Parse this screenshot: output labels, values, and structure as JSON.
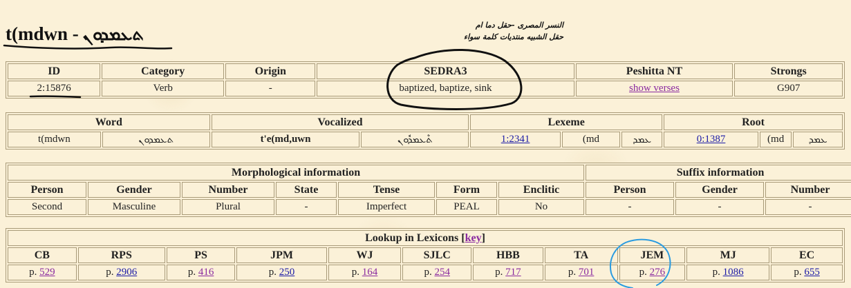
{
  "page_title": {
    "text": "t(mdwn -",
    "syriac": "ܬܥܡܕܘܢ"
  },
  "arabic_note": {
    "line1": "النسر المصرى   -حقل دما ام",
    "line2": "حقل الشبيه منتديات كلمة سواء"
  },
  "table1": {
    "headers": [
      "ID",
      "Category",
      "Origin",
      "SEDRA3",
      "Peshitta NT",
      "Strongs"
    ],
    "values": {
      "id": "2:15876",
      "category": "Verb",
      "origin": "-",
      "sedra3": "baptized, baptize, sink",
      "peshitta": "show verses",
      "strongs": "G907"
    }
  },
  "table2": {
    "headers": [
      "Word",
      "Vocalized",
      "Lexeme",
      "Root"
    ],
    "word": {
      "latin": "t(mdwn",
      "syriac": "ܬܥܡܕܘܢ"
    },
    "vocalized": {
      "latin": "t'e(md,uwn",
      "syriac": "ܬܶܥܡܕܽܘܢ"
    },
    "lexeme": {
      "id": "1:2341",
      "latin": "(md",
      "syriac": "ܥܡܕ"
    },
    "root": {
      "id": "0:1387",
      "latin": "(md",
      "syriac": "ܥܡܕ"
    }
  },
  "table3": {
    "group_morph": "Morphological information",
    "group_suffix": "Suffix information",
    "headers": [
      "Person",
      "Gender",
      "Number",
      "State",
      "Tense",
      "Form",
      "Enclitic",
      "Person",
      "Gender",
      "Number"
    ],
    "values": [
      "Second",
      "Masculine",
      "Plural",
      "-",
      "Imperfect",
      "PEAL",
      "No",
      "-",
      "-",
      "-"
    ]
  },
  "table4": {
    "title": "Lookup in Lexicons [",
    "key_label": "key",
    "title_close": "]",
    "headers": [
      "CB",
      "RPS",
      "PS",
      "JPM",
      "WJ",
      "SJLC",
      "HBB",
      "TA",
      "JEM",
      "MJ",
      "EC"
    ],
    "prefix": "p.",
    "pages": [
      "529",
      "2906",
      "416",
      "250",
      "164",
      "254",
      "717",
      "701",
      "276",
      "1086",
      "655"
    ]
  }
}
